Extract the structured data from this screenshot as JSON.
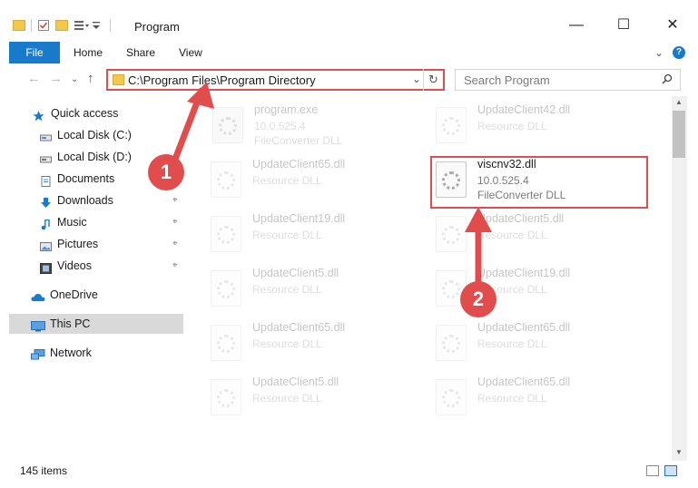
{
  "window": {
    "title": "Program",
    "controls": {
      "minimize": "—",
      "maximize": "☐",
      "close": "✕"
    }
  },
  "ribbon": {
    "tabs": [
      "File",
      "Home",
      "Share",
      "View"
    ],
    "expand": "⌄",
    "help": "?"
  },
  "nav": {
    "back": "←",
    "forward": "→",
    "recent": "⌄",
    "up": "↑"
  },
  "address": {
    "path": "C:\\Program Files\\Program Directory",
    "chevron": "⌄",
    "refresh": "↻"
  },
  "search": {
    "placeholder": "Search Program",
    "icon": "search-icon"
  },
  "sidebar": {
    "items": [
      {
        "label": "Quick access",
        "icon": "star-icon",
        "color": "#1979ca"
      },
      {
        "label": "Local Disk (C:)",
        "icon": "drive-icon",
        "pinned": true
      },
      {
        "label": "Local Disk (D:)",
        "icon": "drive-icon",
        "pinned": true
      },
      {
        "label": "Documents",
        "icon": "documents-icon",
        "pinned": true
      },
      {
        "label": "Downloads",
        "icon": "download-icon",
        "pinned": true
      },
      {
        "label": "Music",
        "icon": "music-icon",
        "pinned": true
      },
      {
        "label": "Pictures",
        "icon": "pictures-icon",
        "pinned": true
      },
      {
        "label": "Videos",
        "icon": "videos-icon",
        "pinned": true
      },
      {
        "label": "OneDrive",
        "icon": "cloud-icon"
      },
      {
        "label": "This PC",
        "icon": "computer-icon",
        "selected": true
      },
      {
        "label": "Network",
        "icon": "network-icon"
      }
    ],
    "pin_glyph": "📌"
  },
  "files": [
    {
      "name": "program.exe",
      "line1": "10.0.525.4",
      "line2": "FileConverter DLL"
    },
    {
      "name": "UpdateClient42.dll",
      "line1": "Resource DLL",
      "line2": ""
    },
    {
      "name": "UpdateClient65.dll",
      "line1": "Resource DLL",
      "line2": ""
    },
    {
      "name": "viscnv32.dll",
      "line1": "10.0.525.4",
      "line2": "FileConverter DLL"
    },
    {
      "name": "UpdateClient19.dll",
      "line1": "Resource DLL",
      "line2": ""
    },
    {
      "name": "UpdateClient5.dll",
      "line1": "Resource DLL",
      "line2": ""
    },
    {
      "name": "UpdateClient5.dll",
      "line1": "Resource DLL",
      "line2": ""
    },
    {
      "name": "UpdateClient19.dll",
      "line1": "Resource DLL",
      "line2": ""
    },
    {
      "name": "UpdateClient65.dll",
      "line1": "Resource DLL",
      "line2": ""
    },
    {
      "name": "UpdateClient65.dll",
      "line1": "Resource DLL",
      "line2": ""
    },
    {
      "name": "UpdateClient5.dll",
      "line1": "Resource DLL",
      "line2": ""
    },
    {
      "name": "UpdateClient65.dll",
      "line1": "Resource DLL",
      "line2": ""
    }
  ],
  "annotations": {
    "step1": "1",
    "step2": "2",
    "color": "#e14c4c"
  },
  "status": {
    "items": "145 items"
  },
  "colors": {
    "accent": "#1979ca",
    "highlight": "#e14c4c",
    "selected_bg": "#d9d9d9"
  }
}
